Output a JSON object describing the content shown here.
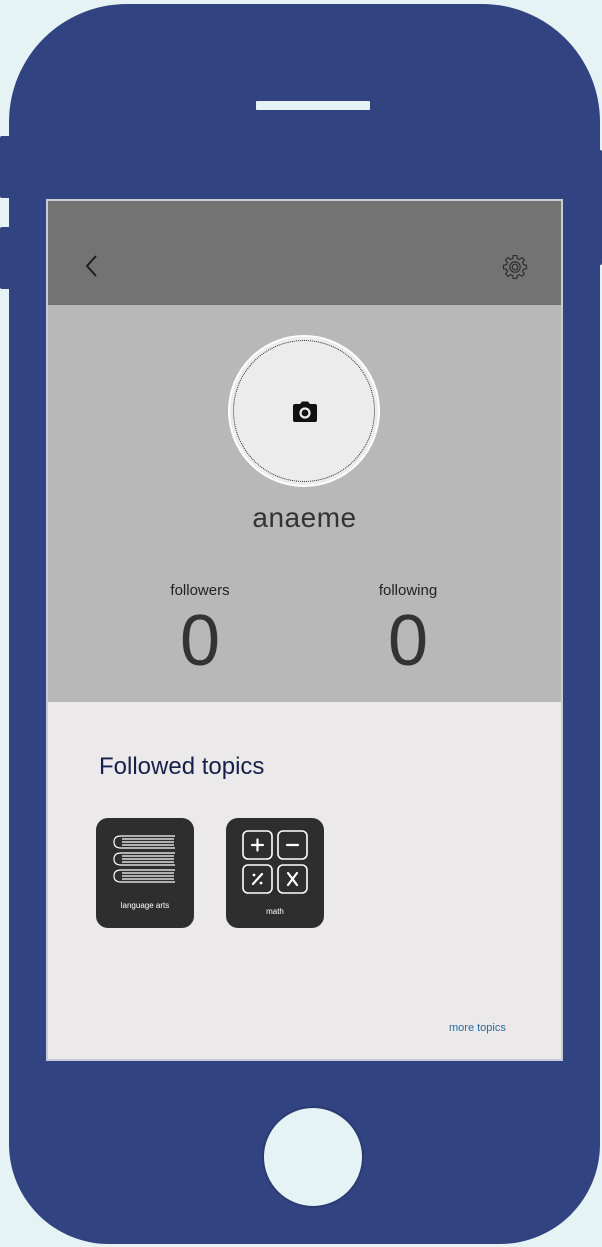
{
  "header": {
    "back_icon": "chevron-left-icon",
    "settings_icon": "gear-icon"
  },
  "profile": {
    "avatar_icon": "camera-icon",
    "username": "anaeme",
    "followers_label": "followers",
    "followers_count": "0",
    "following_label": "following",
    "following_count": "0"
  },
  "topics": {
    "title": "Followed topics",
    "items": [
      {
        "label": "language arts",
        "icon": "books-icon"
      },
      {
        "label": "math",
        "icon": "calculator-icon"
      }
    ],
    "more_label": "more topics"
  },
  "colors": {
    "device": "#324381",
    "background": "#e5f3f5",
    "topbar": "#737373",
    "profile_bg": "#b8b8b8",
    "content_bg": "#ebe9ea",
    "tile": "#2e2e2e",
    "title": "#16204a",
    "link": "#2b6a9e"
  }
}
